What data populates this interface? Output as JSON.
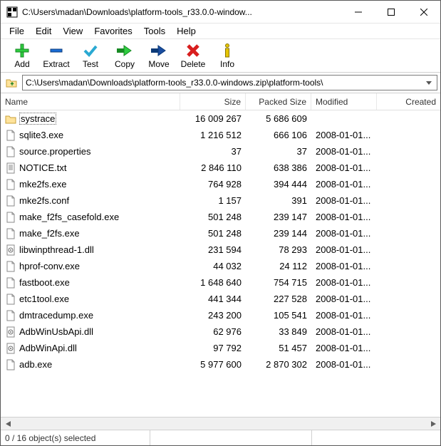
{
  "title": "C:\\Users\\madan\\Downloads\\platform-tools_r33.0.0-window...",
  "menu": [
    "File",
    "Edit",
    "View",
    "Favorites",
    "Tools",
    "Help"
  ],
  "toolbar": [
    {
      "label": "Add",
      "name": "add-button"
    },
    {
      "label": "Extract",
      "name": "extract-button"
    },
    {
      "label": "Test",
      "name": "test-button"
    },
    {
      "label": "Copy",
      "name": "copy-button"
    },
    {
      "label": "Move",
      "name": "move-button"
    },
    {
      "label": "Delete",
      "name": "delete-button"
    },
    {
      "label": "Info",
      "name": "info-button"
    }
  ],
  "path": "C:\\Users\\madan\\Downloads\\platform-tools_r33.0.0-windows.zip\\platform-tools\\",
  "columns": {
    "name": "Name",
    "size": "Size",
    "packed": "Packed Size",
    "modified": "Modified",
    "created": "Created"
  },
  "files": [
    {
      "icon": "folder",
      "name": "systrace",
      "size": "16 009 267",
      "packed": "5 686 609",
      "mod": "",
      "focused": true
    },
    {
      "icon": "exe",
      "name": "sqlite3.exe",
      "size": "1 216 512",
      "packed": "666 106",
      "mod": "2008-01-01..."
    },
    {
      "icon": "file",
      "name": "source.properties",
      "size": "37",
      "packed": "37",
      "mod": "2008-01-01..."
    },
    {
      "icon": "txt",
      "name": "NOTICE.txt",
      "size": "2 846 110",
      "packed": "638 386",
      "mod": "2008-01-01..."
    },
    {
      "icon": "exe",
      "name": "mke2fs.exe",
      "size": "764 928",
      "packed": "394 444",
      "mod": "2008-01-01..."
    },
    {
      "icon": "file",
      "name": "mke2fs.conf",
      "size": "1 157",
      "packed": "391",
      "mod": "2008-01-01..."
    },
    {
      "icon": "exe",
      "name": "make_f2fs_casefold.exe",
      "size": "501 248",
      "packed": "239 147",
      "mod": "2008-01-01..."
    },
    {
      "icon": "exe",
      "name": "make_f2fs.exe",
      "size": "501 248",
      "packed": "239 144",
      "mod": "2008-01-01..."
    },
    {
      "icon": "dll",
      "name": "libwinpthread-1.dll",
      "size": "231 594",
      "packed": "78 293",
      "mod": "2008-01-01..."
    },
    {
      "icon": "exe",
      "name": "hprof-conv.exe",
      "size": "44 032",
      "packed": "24 112",
      "mod": "2008-01-01..."
    },
    {
      "icon": "exe",
      "name": "fastboot.exe",
      "size": "1 648 640",
      "packed": "754 715",
      "mod": "2008-01-01..."
    },
    {
      "icon": "exe",
      "name": "etc1tool.exe",
      "size": "441 344",
      "packed": "227 528",
      "mod": "2008-01-01..."
    },
    {
      "icon": "exe",
      "name": "dmtracedump.exe",
      "size": "243 200",
      "packed": "105 541",
      "mod": "2008-01-01..."
    },
    {
      "icon": "dll",
      "name": "AdbWinUsbApi.dll",
      "size": "62 976",
      "packed": "33 849",
      "mod": "2008-01-01..."
    },
    {
      "icon": "dll",
      "name": "AdbWinApi.dll",
      "size": "97 792",
      "packed": "51 457",
      "mod": "2008-01-01..."
    },
    {
      "icon": "exe",
      "name": "adb.exe",
      "size": "5 977 600",
      "packed": "2 870 302",
      "mod": "2008-01-01..."
    }
  ],
  "status": "0 / 16 object(s) selected"
}
